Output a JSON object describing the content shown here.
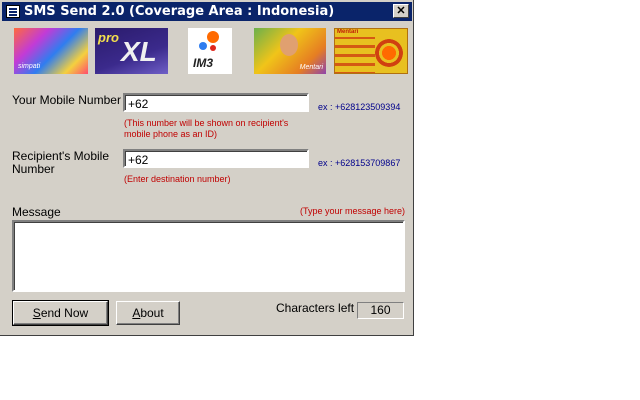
{
  "window": {
    "title": "SMS Send 2.0 (Coverage Area : Indonesia)",
    "close_glyph": "✕"
  },
  "banner": {
    "cards": [
      {
        "name": "simpati",
        "caption": "simpati"
      },
      {
        "name": "proxl",
        "top": "pro",
        "main": "XL"
      },
      {
        "name": "im3",
        "text": "IM3"
      },
      {
        "name": "mentari-person",
        "caption": "Mentari"
      },
      {
        "name": "mentari-sun",
        "caption": "Mentari"
      }
    ]
  },
  "form": {
    "your_number_label": "Your Mobile Number",
    "your_number_value": "+62",
    "your_number_example": "ex : +628123509394",
    "your_number_hint": "(This number will be shown on recipient's mobile phone as an ID)",
    "recipient_label": "Recipient's Mobile Number",
    "recipient_value": "+62",
    "recipient_example": "ex : +628153709867",
    "recipient_hint": "(Enter destination number)",
    "message_label": "Message",
    "message_hint": "(Type your message here)",
    "message_value": "",
    "chars_left_label": "Characters left",
    "chars_left_value": "160"
  },
  "buttons": {
    "send_label": "Send Now",
    "send_accel": "S",
    "send_rest": "end Now",
    "about_label": "About",
    "about_accel": "A",
    "about_rest": "bout"
  }
}
